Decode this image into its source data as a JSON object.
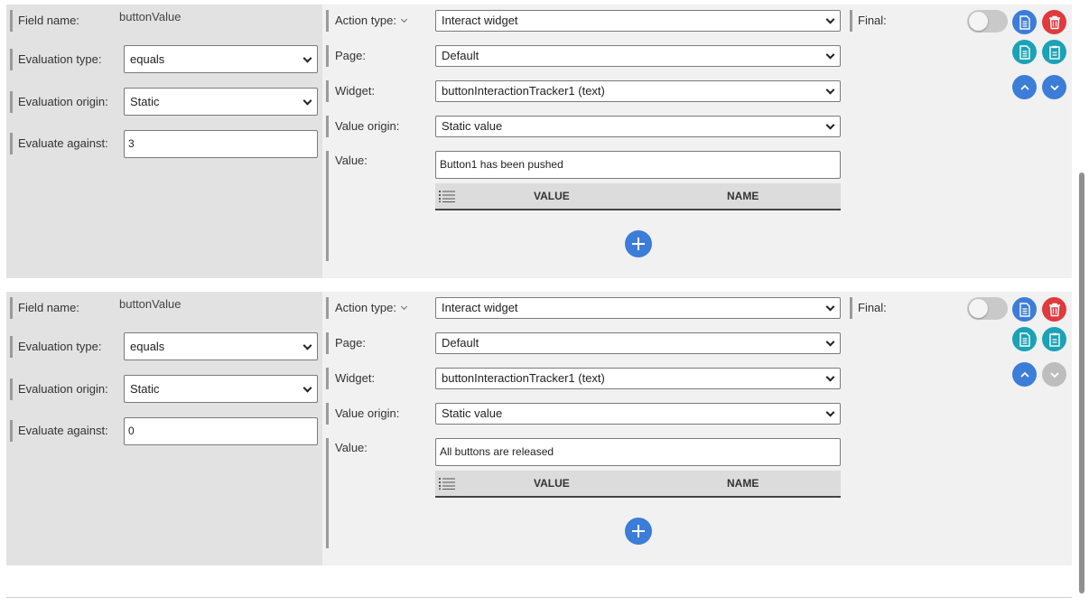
{
  "labels": {
    "field_name": "Field name:",
    "evaluation_type": "Evaluation type:",
    "evaluation_origin": "Evaluation origin:",
    "evaluate_against": "Evaluate against:",
    "action_type": "Action type:",
    "page": "Page:",
    "widget": "Widget:",
    "value_origin": "Value origin:",
    "value": "Value:",
    "final": "Final:",
    "col_value": "VALUE",
    "col_name": "NAME"
  },
  "rules": [
    {
      "field_name": "buttonValue",
      "evaluation_type": "equals",
      "evaluation_origin": "Static",
      "evaluate_against": "3",
      "action_type": "Interact widget",
      "page": "Default",
      "widget": "buttonInteractionTracker1 (text)",
      "value_origin": "Static value",
      "value": "Button1 has been pushed",
      "final": false,
      "move_down_enabled": true
    },
    {
      "field_name": "buttonValue",
      "evaluation_type": "equals",
      "evaluation_origin": "Static",
      "evaluate_against": "0",
      "action_type": "Interact widget",
      "page": "Default",
      "widget": "buttonInteractionTracker1 (text)",
      "value_origin": "Static value",
      "value": "All buttons are released",
      "final": false,
      "move_down_enabled": false
    }
  ],
  "icons": {
    "copy": "copy-icon",
    "delete": "trash-icon",
    "duplicate": "duplicate-icon",
    "paste": "paste-icon",
    "move_up": "chevron-up-icon",
    "move_down": "chevron-down-icon",
    "add": "plus-icon",
    "list": "list-icon"
  },
  "colors": {
    "primary": "#3b7dd8",
    "danger": "#e0393e",
    "teal": "#1ba2b6",
    "disabled": "#bdbdbd"
  }
}
